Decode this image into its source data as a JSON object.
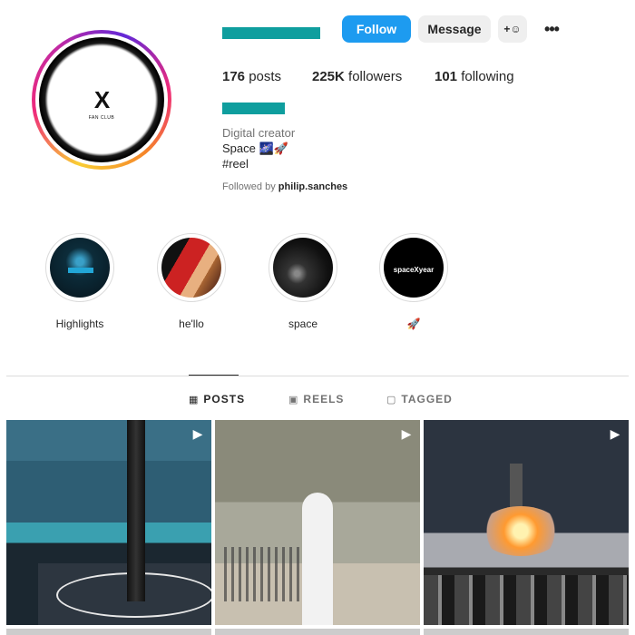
{
  "header": {
    "follow_label": "Follow",
    "message_label": "Message",
    "adduser_label": "+☺",
    "more_label": "•••"
  },
  "stats": {
    "posts_count": "176",
    "posts_label": "posts",
    "followers_count": "225K",
    "followers_label": "followers",
    "following_count": "101",
    "following_label": "following"
  },
  "avatar": {
    "logo_text": "X",
    "caption": "FAN CLUB"
  },
  "bio": {
    "category": "Digital creator",
    "line1": "Space 🌌🚀",
    "line2": "#reel",
    "followed_by_prefix": "Followed by",
    "followed_by_user": "philip.sanches"
  },
  "highlights": [
    {
      "label": "Highlights",
      "icon": "highlight-cover-1"
    },
    {
      "label": "he'llo",
      "icon": "highlight-cover-2"
    },
    {
      "label": "space",
      "icon": "highlight-cover-3"
    },
    {
      "label": "🚀",
      "icon": "highlight-cover-4",
      "cover_text": "spaceXyear"
    }
  ],
  "tabs": [
    {
      "label": "POSTS",
      "icon": "grid-icon",
      "active": true
    },
    {
      "label": "REELS",
      "icon": "reels-icon",
      "active": false
    },
    {
      "label": "TAGGED",
      "icon": "tagged-icon",
      "active": false
    }
  ],
  "tab_icons": {
    "posts": "▦",
    "reels": "▣",
    "tagged": "▢"
  },
  "posts": [
    {
      "type": "reel",
      "reel_icon": "▶"
    },
    {
      "type": "reel",
      "reel_icon": "▶"
    },
    {
      "type": "reel",
      "reel_icon": "▶"
    }
  ],
  "colors": {
    "follow_button": "#1d9bf0",
    "redaction": "#0f9e9e",
    "secondary_button": "#efefef"
  }
}
